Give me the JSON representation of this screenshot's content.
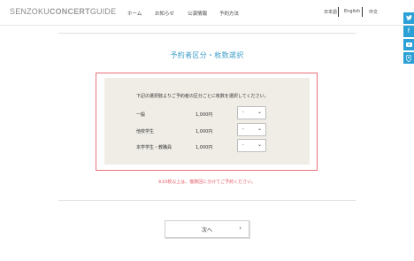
{
  "logo": {
    "part1": "SENZOKU",
    "part2": "CONCERT",
    "part3": "GUIDE"
  },
  "nav": [
    "ホーム",
    "お知らせ",
    "公演情報",
    "予約方法"
  ],
  "lang": [
    "日本語",
    "English",
    "中文"
  ],
  "social": [
    "twitter-icon",
    "facebook-icon",
    "youtube-icon",
    "map-pin-icon"
  ],
  "page": {
    "title": "予約者区分・枚数選択",
    "instruction": "下記の選択肢よりご予約者の区分ごとに枚数を選択してください。",
    "tickets": [
      {
        "label": "一般",
        "price": "1,000円",
        "selected": "-"
      },
      {
        "label": "他校学生",
        "price": "1,000円",
        "selected": "-"
      },
      {
        "label": "本学学生・教職員",
        "price": "1,000円",
        "selected": "-"
      }
    ],
    "note": "※10枚以上は、複数回に分けてご予約ください。",
    "next_label": "次へ"
  }
}
